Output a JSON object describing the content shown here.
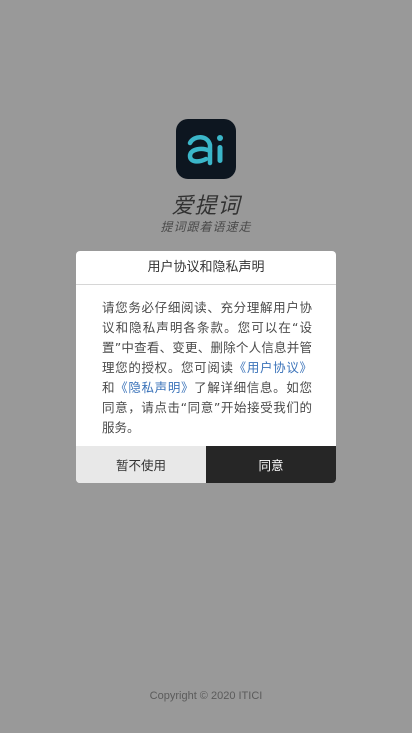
{
  "app": {
    "name": "爱提词",
    "tagline": "提词跟着语速走",
    "icon": "ai-logo-icon"
  },
  "dialog": {
    "title": "用户协议和隐私声明",
    "body_part1": "请您务必仔细阅读、充分理解用户协议和隐私声明各条款。您可以在“设置”中查看、变更、删除个人信息并管理您的授权。您可阅读",
    "link_user_agreement": "《用户协议》",
    "body_and": "和",
    "link_privacy": "《隐私声明》",
    "body_part2": "了解详细信息。如您同意，请点击“同意”开始接受我们的服务。",
    "cancel_label": "暂不使用",
    "agree_label": "同意"
  },
  "footer": {
    "copyright": "Copyright © 2020 ITICI"
  },
  "colors": {
    "overlay": "#999999",
    "link": "#3b73b9",
    "agree_button": "#262626",
    "cancel_button": "#e8e8e8",
    "logo_accent": "#3bb6c9"
  }
}
